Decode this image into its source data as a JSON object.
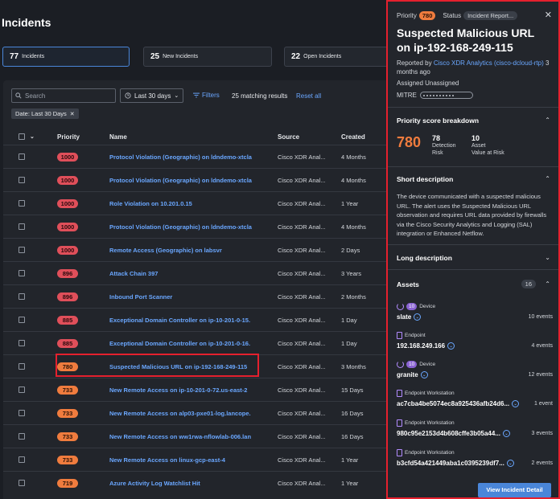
{
  "page": {
    "title": "Incidents"
  },
  "metrics": [
    {
      "num": "77",
      "label": "Incidents"
    },
    {
      "num": "25",
      "label": "New Incidents"
    },
    {
      "num": "22",
      "label": "Open Incidents"
    }
  ],
  "toolbar": {
    "search_placeholder": "Search",
    "date_range": "Last 30 days",
    "filters": "Filters",
    "matching": "25 matching results",
    "reset": "Reset all",
    "chip": "Date: Last 30 Days"
  },
  "table": {
    "headers": {
      "priority": "Priority",
      "name": "Name",
      "source": "Source",
      "created": "Created"
    },
    "rows": [
      {
        "priority": "1000",
        "level": "red",
        "name": "Protocol Violation (Geographic) on ldndemo-xtcla",
        "source": "Cisco XDR Anal...",
        "created": "4 Months"
      },
      {
        "priority": "1000",
        "level": "red",
        "name": "Protocol Violation (Geographic) on ldndemo-xtcla",
        "source": "Cisco XDR Anal...",
        "created": "4 Months"
      },
      {
        "priority": "1000",
        "level": "red",
        "name": "Role Violation on 10.201.0.15",
        "source": "Cisco XDR Anal...",
        "created": "1 Year"
      },
      {
        "priority": "1000",
        "level": "red",
        "name": "Protocol Violation (Geographic) on ldndemo-xtcla",
        "source": "Cisco XDR Anal...",
        "created": "4 Months"
      },
      {
        "priority": "1000",
        "level": "red",
        "name": "Remote Access (Geographic) on labsvr",
        "source": "Cisco XDR Anal...",
        "created": "2 Days"
      },
      {
        "priority": "896",
        "level": "red",
        "name": "Attack Chain 397",
        "source": "Cisco XDR Anal...",
        "created": "3 Years"
      },
      {
        "priority": "896",
        "level": "red",
        "name": "Inbound Port Scanner",
        "source": "Cisco XDR Anal...",
        "created": "2 Months"
      },
      {
        "priority": "885",
        "level": "red",
        "name": "Exceptional Domain Controller on ip-10-201-0-15.",
        "source": "Cisco XDR Anal...",
        "created": "1 Day"
      },
      {
        "priority": "885",
        "level": "red",
        "name": "Exceptional Domain Controller on ip-10-201-0-16.",
        "source": "Cisco XDR Anal...",
        "created": "1 Day"
      },
      {
        "priority": "780",
        "level": "orange",
        "name": "Suspected Malicious URL on ip-192-168-249-115",
        "source": "Cisco XDR Anal...",
        "created": "3 Months"
      },
      {
        "priority": "733",
        "level": "orange",
        "name": "New Remote Access on ip-10-201-0-72.us-east-2",
        "source": "Cisco XDR Anal...",
        "created": "15 Days"
      },
      {
        "priority": "733",
        "level": "orange",
        "name": "New Remote Access on alp03-pxe01-log.lancope.",
        "source": "Cisco XDR Anal...",
        "created": "16 Days"
      },
      {
        "priority": "733",
        "level": "orange",
        "name": "New Remote Access on ww1rwa-nflowlab-006.lan",
        "source": "Cisco XDR Anal...",
        "created": "16 Days"
      },
      {
        "priority": "733",
        "level": "orange",
        "name": "New Remote Access on linux-gcp-east-4",
        "source": "Cisco XDR Anal...",
        "created": "1 Year"
      },
      {
        "priority": "719",
        "level": "orange",
        "name": "Azure Activity Log Watchlist Hit",
        "source": "Cisco XDR Anal...",
        "created": "1 Year"
      }
    ]
  },
  "drawer": {
    "priority_label": "Priority",
    "priority_value": "780",
    "status_label": "Status",
    "status_value": "Incident Report...",
    "title": "Suspected Malicious URL on ip-192-168-249-115",
    "reported_by_label": "Reported by",
    "reported_by_link": "Cisco XDR Analytics (cisco-dcloud-rtp)",
    "reported_ago": "3 months ago",
    "assigned": "Assigned Unassigned",
    "mitre_label": "MITRE",
    "score_section": "Priority score breakdown",
    "score": "780",
    "detection_risk_value": "78",
    "detection_risk_label1": "Detection",
    "detection_risk_label2": "Risk",
    "asset_value_value": "10",
    "asset_value_label1": "Asset",
    "asset_value_label2": "Value at Risk",
    "short_desc_title": "Short description",
    "short_desc": "The device communicated with a suspected malicious URL. The alert uses the Suspected Malicious URL observation and requires URL data provided by firewalls via the Cisco Security Analytics and Logging (SAL) integration or Enhanced Netflow.",
    "long_desc_title": "Long description",
    "assets_title": "Assets",
    "assets_count": "16",
    "assets": [
      {
        "type": "Device",
        "score": "10",
        "value": "slate",
        "events": "10 events",
        "icon": "power-icon"
      },
      {
        "type": "Endpoint",
        "score": "",
        "value": "192.168.249.166",
        "events": "4 events",
        "icon": "endpoint-icon"
      },
      {
        "type": "Device",
        "score": "10",
        "value": "granite",
        "events": "12 events",
        "icon": "power-icon"
      },
      {
        "type": "Endpoint Workstation",
        "score": "",
        "value": "ac7cba4be5074ec8a925436afb24d6...",
        "events": "1 event",
        "icon": "endpoint-icon"
      },
      {
        "type": "Endpoint Workstation",
        "score": "",
        "value": "980c95e2153d4b608cffe3b05a44...",
        "events": "3 events",
        "icon": "endpoint-icon"
      },
      {
        "type": "Endpoint Workstation",
        "score": "",
        "value": "b3cfd54a421449aba1c0395239df7...",
        "events": "2 events",
        "icon": "endpoint-icon"
      }
    ],
    "view_button": "View Incident Detail"
  },
  "colors": {
    "accent": "#4a86d9",
    "link": "#6aa7ff",
    "priority_red": "#e04f5a",
    "priority_orange": "#f07c3e",
    "highlight": "#e5202e"
  }
}
